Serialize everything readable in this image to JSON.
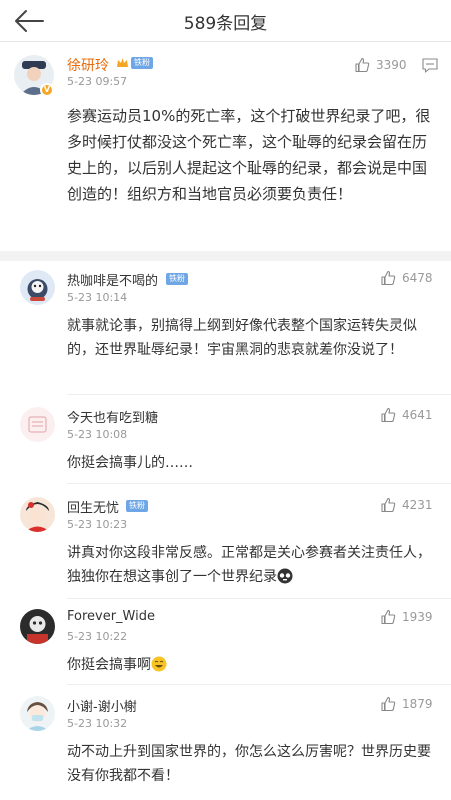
{
  "header": {
    "title": "589条回复"
  },
  "post": {
    "author": "徐研玲",
    "level_badge": "铁粉",
    "time": "5-23 09:57",
    "likes": "3390",
    "text": "参赛运动员10%的死亡率，这个打破世界纪录了吧，很多时候打仗都没这个死亡率，这个耻辱的纪录会留在历史上的，以后别人提起这个耻辱的纪录，都会说是中国创造的！组织方和当地官员必须要负责任！"
  },
  "replies": [
    {
      "author": "热咖啡是不喝的",
      "badge": "铁粉",
      "time": "5-23 10:14",
      "likes": "6478",
      "text": "就事就论事，别搞得上纲到好像代表整个国家运转失灵似的，还世界耻辱纪录！宇宙黑洞的悲哀就差你没说了！"
    },
    {
      "author": "今天也有吃到糖",
      "badge": "",
      "time": "5-23 10:08",
      "likes": "4641",
      "text": "你挺会搞事儿的……"
    },
    {
      "author": "回生无忧",
      "badge": "铁粉",
      "time": "5-23 10:23",
      "likes": "4231",
      "text": "讲真对你这段非常反感。正常都是关心参赛者关注责任人，独独你在想这事创了一个世界纪录"
    },
    {
      "author": "Forever_Wide",
      "badge": "",
      "time": "5-23 10:22",
      "likes": "1939",
      "text": "你挺会搞事啊"
    },
    {
      "author": "小谢-谢小榭",
      "badge": "",
      "time": "5-23 10:32",
      "likes": "1879",
      "text": "动不动上升到国家世界的，你怎么这么厉害呢？世界历史要没有你我都不看！"
    }
  ],
  "colors": {
    "name_orange": "#e86b0c",
    "badge_blue": "#6fa6e6",
    "muted": "#999999",
    "divider": "#f2f2f2"
  }
}
